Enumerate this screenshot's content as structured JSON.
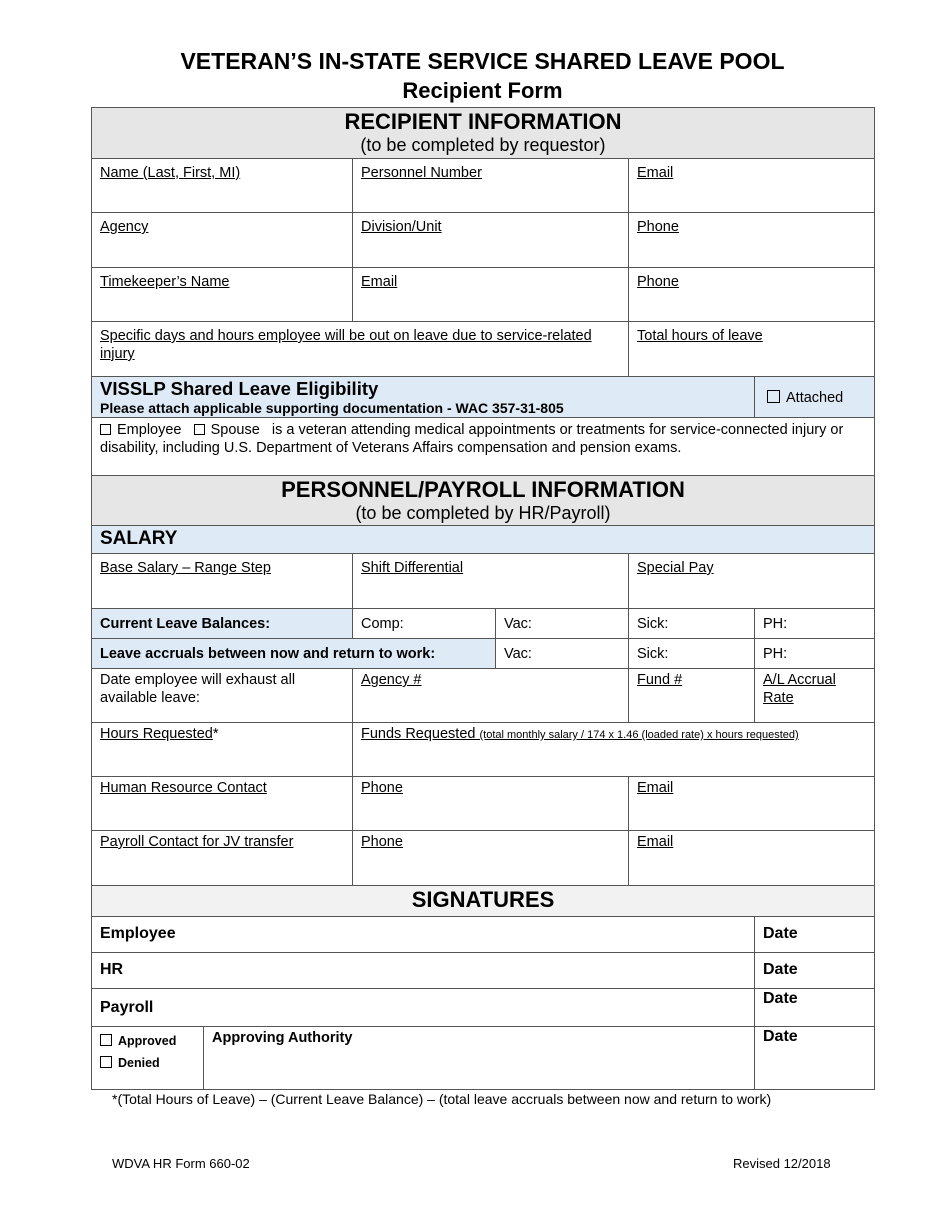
{
  "title": {
    "main": "VETERAN’S IN-STATE SERVICE SHARED LEAVE POOL",
    "sub": "Recipient Form"
  },
  "recipient_section": {
    "heading": "RECIPIENT INFORMATION",
    "subheading": "(to be completed by requestor)",
    "fields": {
      "name": "Name (Last, First, MI)",
      "personnel_number": "Personnel Number",
      "email": "Email",
      "agency": "Agency",
      "division_unit": "Division/Unit",
      "phone": "Phone",
      "timekeeper_name": "Timekeeper’s Name",
      "timekeeper_email": "Email",
      "timekeeper_phone": "Phone",
      "specific_days": "Specific days and hours employee will be out on leave due to service-related injury",
      "total_hours": "Total hours of leave"
    }
  },
  "eligibility": {
    "heading": "VISSLP Shared Leave Eligibility",
    "note": "Please attach applicable supporting documentation - WAC 357-31-805",
    "attached_label": "Attached",
    "employee_label": "Employee",
    "spouse_label": "Spouse",
    "statement": "is a veteran attending medical appointments or treatments for service-connected injury or disability, including U.S. Department of Veterans Affairs compensation and pension exams."
  },
  "payroll_section": {
    "heading": "PERSONNEL/PAYROLL INFORMATION",
    "subheading": "(to be completed by HR/Payroll)",
    "salary_heading": "SALARY",
    "fields": {
      "base_salary": "Base Salary – Range Step",
      "shift_differential": "Shift Differential",
      "special_pay": "Special Pay",
      "current_leave_balances": "Current Leave Balances:",
      "comp": "Comp:",
      "vac": "Vac:",
      "sick": "Sick:",
      "ph": "PH:",
      "leave_accruals": "Leave accruals between now and return to work:",
      "accrual_vac": "Vac:",
      "accrual_sick": "Sick:",
      "accrual_ph": "PH:",
      "exhaust_date": "Date employee will exhaust all available leave:",
      "agency_number": "Agency #",
      "fund_number": "Fund #",
      "al_accrual_rate": "A/L Accrual Rate",
      "hours_requested": "Hours Requested",
      "hours_requested_mark": "*",
      "funds_requested": "Funds Requested",
      "funds_formula": "(total monthly salary / 174 x 1.46 (loaded rate) x hours requested)",
      "hr_contact": "Human Resource Contact",
      "hr_phone": "Phone",
      "hr_email": "Email",
      "payroll_contact": "Payroll Contact for JV transfer",
      "payroll_phone": "Phone",
      "payroll_email": "Email"
    }
  },
  "signatures": {
    "heading": "SIGNATURES",
    "employee": "Employee",
    "hr": "HR",
    "payroll": "Payroll",
    "approved": "Approved",
    "denied": "Denied",
    "approving_authority": "Approving Authority",
    "date": "Date"
  },
  "footnote": "*(Total Hours of Leave) – (Current Leave Balance) – (total leave accruals between now and return to work)",
  "footer": {
    "form_id": "WDVA HR Form 660-02",
    "revised": "Revised 12/2018"
  }
}
